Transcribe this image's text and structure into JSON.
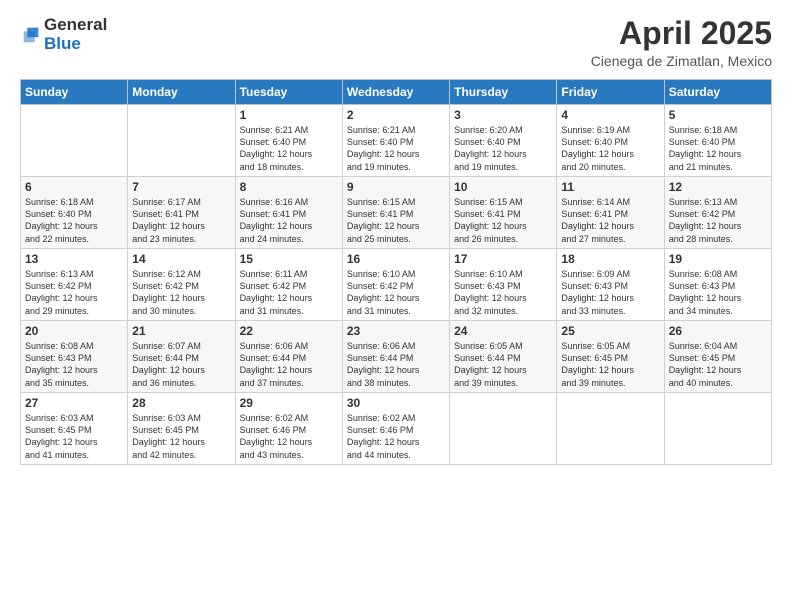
{
  "header": {
    "logo_general": "General",
    "logo_blue": "Blue",
    "month_title": "April 2025",
    "location": "Cienega de Zimatlan, Mexico"
  },
  "days_of_week": [
    "Sunday",
    "Monday",
    "Tuesday",
    "Wednesday",
    "Thursday",
    "Friday",
    "Saturday"
  ],
  "weeks": [
    [
      {
        "day": "",
        "sunrise": "",
        "sunset": "",
        "daylight": ""
      },
      {
        "day": "",
        "sunrise": "",
        "sunset": "",
        "daylight": ""
      },
      {
        "day": "1",
        "sunrise": "Sunrise: 6:21 AM",
        "sunset": "Sunset: 6:40 PM",
        "daylight": "Daylight: 12 hours and 18 minutes."
      },
      {
        "day": "2",
        "sunrise": "Sunrise: 6:21 AM",
        "sunset": "Sunset: 6:40 PM",
        "daylight": "Daylight: 12 hours and 19 minutes."
      },
      {
        "day": "3",
        "sunrise": "Sunrise: 6:20 AM",
        "sunset": "Sunset: 6:40 PM",
        "daylight": "Daylight: 12 hours and 19 minutes."
      },
      {
        "day": "4",
        "sunrise": "Sunrise: 6:19 AM",
        "sunset": "Sunset: 6:40 PM",
        "daylight": "Daylight: 12 hours and 20 minutes."
      },
      {
        "day": "5",
        "sunrise": "Sunrise: 6:18 AM",
        "sunset": "Sunset: 6:40 PM",
        "daylight": "Daylight: 12 hours and 21 minutes."
      }
    ],
    [
      {
        "day": "6",
        "sunrise": "Sunrise: 6:18 AM",
        "sunset": "Sunset: 6:40 PM",
        "daylight": "Daylight: 12 hours and 22 minutes."
      },
      {
        "day": "7",
        "sunrise": "Sunrise: 6:17 AM",
        "sunset": "Sunset: 6:41 PM",
        "daylight": "Daylight: 12 hours and 23 minutes."
      },
      {
        "day": "8",
        "sunrise": "Sunrise: 6:16 AM",
        "sunset": "Sunset: 6:41 PM",
        "daylight": "Daylight: 12 hours and 24 minutes."
      },
      {
        "day": "9",
        "sunrise": "Sunrise: 6:15 AM",
        "sunset": "Sunset: 6:41 PM",
        "daylight": "Daylight: 12 hours and 25 minutes."
      },
      {
        "day": "10",
        "sunrise": "Sunrise: 6:15 AM",
        "sunset": "Sunset: 6:41 PM",
        "daylight": "Daylight: 12 hours and 26 minutes."
      },
      {
        "day": "11",
        "sunrise": "Sunrise: 6:14 AM",
        "sunset": "Sunset: 6:41 PM",
        "daylight": "Daylight: 12 hours and 27 minutes."
      },
      {
        "day": "12",
        "sunrise": "Sunrise: 6:13 AM",
        "sunset": "Sunset: 6:42 PM",
        "daylight": "Daylight: 12 hours and 28 minutes."
      }
    ],
    [
      {
        "day": "13",
        "sunrise": "Sunrise: 6:13 AM",
        "sunset": "Sunset: 6:42 PM",
        "daylight": "Daylight: 12 hours and 29 minutes."
      },
      {
        "day": "14",
        "sunrise": "Sunrise: 6:12 AM",
        "sunset": "Sunset: 6:42 PM",
        "daylight": "Daylight: 12 hours and 30 minutes."
      },
      {
        "day": "15",
        "sunrise": "Sunrise: 6:11 AM",
        "sunset": "Sunset: 6:42 PM",
        "daylight": "Daylight: 12 hours and 31 minutes."
      },
      {
        "day": "16",
        "sunrise": "Sunrise: 6:10 AM",
        "sunset": "Sunset: 6:42 PM",
        "daylight": "Daylight: 12 hours and 31 minutes."
      },
      {
        "day": "17",
        "sunrise": "Sunrise: 6:10 AM",
        "sunset": "Sunset: 6:43 PM",
        "daylight": "Daylight: 12 hours and 32 minutes."
      },
      {
        "day": "18",
        "sunrise": "Sunrise: 6:09 AM",
        "sunset": "Sunset: 6:43 PM",
        "daylight": "Daylight: 12 hours and 33 minutes."
      },
      {
        "day": "19",
        "sunrise": "Sunrise: 6:08 AM",
        "sunset": "Sunset: 6:43 PM",
        "daylight": "Daylight: 12 hours and 34 minutes."
      }
    ],
    [
      {
        "day": "20",
        "sunrise": "Sunrise: 6:08 AM",
        "sunset": "Sunset: 6:43 PM",
        "daylight": "Daylight: 12 hours and 35 minutes."
      },
      {
        "day": "21",
        "sunrise": "Sunrise: 6:07 AM",
        "sunset": "Sunset: 6:44 PM",
        "daylight": "Daylight: 12 hours and 36 minutes."
      },
      {
        "day": "22",
        "sunrise": "Sunrise: 6:06 AM",
        "sunset": "Sunset: 6:44 PM",
        "daylight": "Daylight: 12 hours and 37 minutes."
      },
      {
        "day": "23",
        "sunrise": "Sunrise: 6:06 AM",
        "sunset": "Sunset: 6:44 PM",
        "daylight": "Daylight: 12 hours and 38 minutes."
      },
      {
        "day": "24",
        "sunrise": "Sunrise: 6:05 AM",
        "sunset": "Sunset: 6:44 PM",
        "daylight": "Daylight: 12 hours and 39 minutes."
      },
      {
        "day": "25",
        "sunrise": "Sunrise: 6:05 AM",
        "sunset": "Sunset: 6:45 PM",
        "daylight": "Daylight: 12 hours and 39 minutes."
      },
      {
        "day": "26",
        "sunrise": "Sunrise: 6:04 AM",
        "sunset": "Sunset: 6:45 PM",
        "daylight": "Daylight: 12 hours and 40 minutes."
      }
    ],
    [
      {
        "day": "27",
        "sunrise": "Sunrise: 6:03 AM",
        "sunset": "Sunset: 6:45 PM",
        "daylight": "Daylight: 12 hours and 41 minutes."
      },
      {
        "day": "28",
        "sunrise": "Sunrise: 6:03 AM",
        "sunset": "Sunset: 6:45 PM",
        "daylight": "Daylight: 12 hours and 42 minutes."
      },
      {
        "day": "29",
        "sunrise": "Sunrise: 6:02 AM",
        "sunset": "Sunset: 6:46 PM",
        "daylight": "Daylight: 12 hours and 43 minutes."
      },
      {
        "day": "30",
        "sunrise": "Sunrise: 6:02 AM",
        "sunset": "Sunset: 6:46 PM",
        "daylight": "Daylight: 12 hours and 44 minutes."
      },
      {
        "day": "",
        "sunrise": "",
        "sunset": "",
        "daylight": ""
      },
      {
        "day": "",
        "sunrise": "",
        "sunset": "",
        "daylight": ""
      },
      {
        "day": "",
        "sunrise": "",
        "sunset": "",
        "daylight": ""
      }
    ]
  ]
}
